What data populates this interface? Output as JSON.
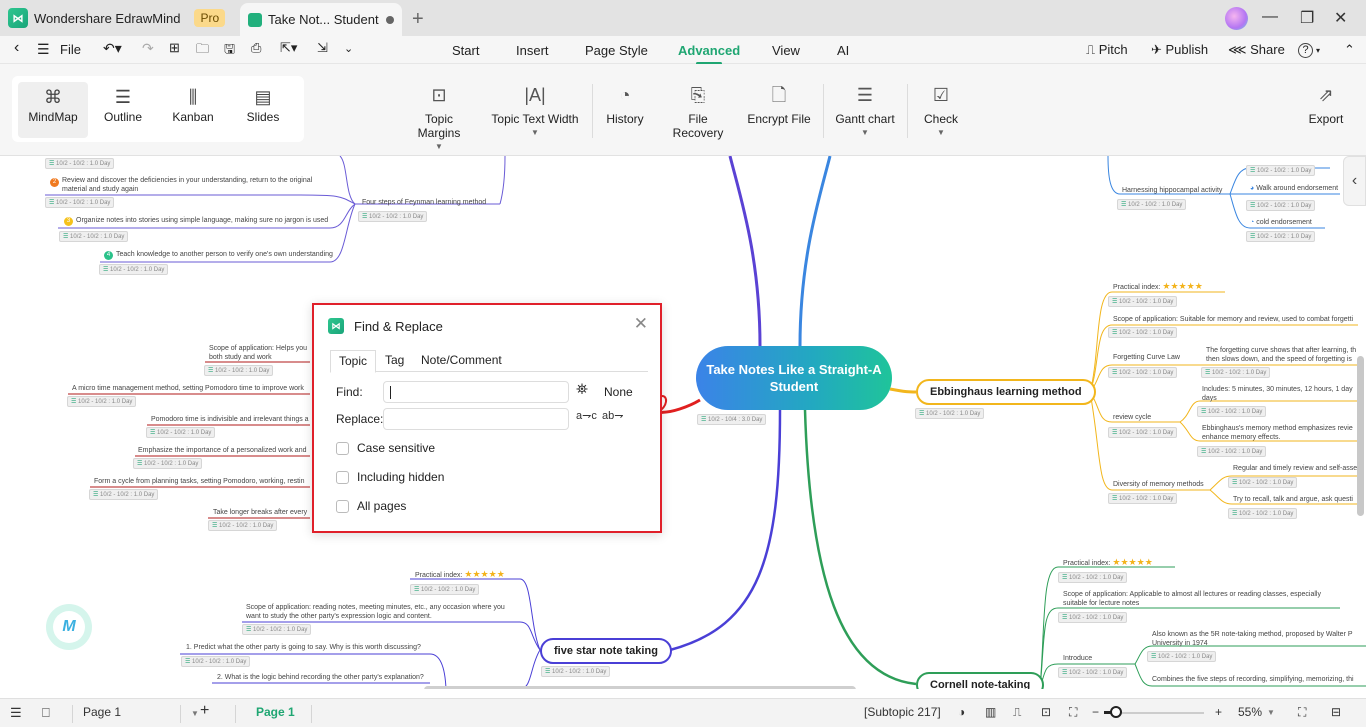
{
  "titlebar": {
    "app_name": "Wondershare EdrawMind",
    "badge": "Pro",
    "doc_tab": "Take Not... Student",
    "new_tab": "+",
    "minimize": "—",
    "restore": "❐",
    "close": "✕"
  },
  "menubar": {
    "back": "‹",
    "menu": "☰",
    "file": "File",
    "tabs": [
      "Start",
      "Insert",
      "Page Style",
      "Advanced",
      "View",
      "AI"
    ],
    "active_tab": "Advanced",
    "right": {
      "pitch": "Pitch",
      "publish": "Publish",
      "share": "Share",
      "help": "?",
      "collapse": "⌃"
    }
  },
  "ribbon": {
    "views": [
      {
        "label": "MindMap",
        "icon": "mindmap-icon",
        "active": true
      },
      {
        "label": "Outline",
        "icon": "outline-icon"
      },
      {
        "label": "Kanban",
        "icon": "kanban-icon"
      },
      {
        "label": "Slides",
        "icon": "slides-icon"
      }
    ],
    "tools": [
      {
        "label": "Topic Margins",
        "icon": "topic-margins-icon",
        "dropdown": true
      },
      {
        "label": "Topic Text Width",
        "icon": "topic-text-width-icon",
        "dropdown": true
      },
      {
        "label": "History",
        "icon": "history-icon"
      },
      {
        "label": "File Recovery",
        "icon": "file-recovery-icon"
      },
      {
        "label": "Encrypt File",
        "icon": "encrypt-file-icon"
      },
      {
        "label": "Gantt chart",
        "icon": "gantt-chart-icon",
        "dropdown": true
      },
      {
        "label": "Check",
        "icon": "check-icon",
        "dropdown": true
      },
      {
        "label": "Export",
        "icon": "export-icon"
      }
    ]
  },
  "mindmap": {
    "central": "Take Notes Like a Straight-A Student",
    "central_tag": "10/2 - 10/4 : 3.0 Day",
    "main_topics": [
      {
        "label": "Ebbinghaus learning method",
        "color": "#f2b61c",
        "tag": "10/2 - 10/2 : 1.0 Day"
      },
      {
        "label": "five star note taking",
        "color": "#4a3fd6",
        "tag": "10/2 - 10/2 : 1.0 Day"
      },
      {
        "label": "Cornell note-taking",
        "color": "#2e9e58"
      }
    ],
    "feynman": {
      "label": "Four steps of Feynman learning method",
      "tag": "10/2 - 10/2 : 1.0 Day",
      "steps": [
        {
          "num": "2",
          "text": "Review and discover the deficiencies in your understanding, return to the original",
          "text2": "material and study again",
          "tag": "10/2 - 10/2 : 1.0 Day"
        },
        {
          "num": "3",
          "text": "Organize notes into stories using simple language, making sure no jargon is used",
          "tag": "10/2 - 10/2 : 1.0 Day"
        },
        {
          "num": "4",
          "text": "Teach knowledge to another person to verify one's own understanding",
          "tag": "10/2 - 10/2 : 1.0 Day"
        }
      ],
      "top_tag": "10/2 - 10/2 : 1.0 Day"
    },
    "pomodoro": [
      {
        "text": "Scope of application: Helps you",
        "text2": "both study and work",
        "tag": "10/2 - 10/2 : 1.0 Day"
      },
      {
        "text": "A micro time management method, setting Pomodoro time to improve work",
        "tag": "10/2 - 10/2 : 1.0 Day"
      },
      {
        "text": "Pomodoro time is indivisible and irrelevant things a",
        "tag": "10/2 - 10/2 : 1.0 Day"
      },
      {
        "text": "Emphasize the importance of a personalized work and",
        "tag": "10/2 - 10/2 : 1.0 Day"
      },
      {
        "text": "Form a cycle from planning tasks, setting Pomodoro, working, restin",
        "tag": "10/2 - 10/2 : 1.0 Day"
      },
      {
        "text": "Take longer breaks after every",
        "tag": "10/2 - 10/2 : 1.0 Day"
      }
    ],
    "hippocampal": {
      "label": "Harnessing hippocampal activity",
      "tag": "10/2 - 10/2 : 1.0 Day",
      "items": [
        {
          "text": "",
          "tag": "10/2 - 10/2 : 1.0 Day"
        },
        {
          "text": "Walk around endorsement",
          "tag": "10/2 - 10/2 : 1.0 Day"
        },
        {
          "text": "cold endorsement",
          "tag": "10/2 - 10/2 : 1.0 Day"
        }
      ]
    },
    "ebbinghaus": {
      "practical_label": "Practical index:",
      "practical_stars": 5,
      "practical_tag": "10/2 - 10/2 : 1.0 Day",
      "scope": "Scope of application: Suitable for memory and review, used to combat forgetti",
      "scope_tag": "10/2 - 10/2 : 1.0 Day",
      "forgetting": "Forgetting Curve Law",
      "forgetting_tag": "10/2 - 10/2 : 1.0 Day",
      "forgetting_detail": "The forgetting curve shows that after learning, th",
      "forgetting_detail2": "then slows down, and the speed of forgetting is",
      "forgetting_detail_tag": "10/2 - 10/2 : 1.0 Day",
      "review": "review cycle",
      "review_tag": "10/2 - 10/2 : 1.0 Day",
      "review_a": "Includes: 5 minutes, 30 minutes, 12 hours, 1 day",
      "review_a2": "days",
      "review_a_tag": "10/2 - 10/2 : 1.0 Day",
      "review_b": "Ebbinghaus's memory method emphasizes revie",
      "review_b2": "enhance memory effects.",
      "review_b_tag": "10/2 - 10/2 : 1.0 Day",
      "diversity": "Diversity of memory methods",
      "diversity_tag": "10/2 - 10/2 : 1.0 Day",
      "diversity_a": "Regular and timely review and self-asse",
      "diversity_a_tag": "10/2 - 10/2 : 1.0 Day",
      "diversity_b": "Try to recall, talk and argue, ask questi",
      "diversity_b_tag": "10/2 - 10/2 : 1.0 Day"
    },
    "five_star": {
      "practical_label": "Practical index:",
      "practical_stars": 5,
      "practical_tag": "10/2 - 10/2 : 1.0 Day",
      "scope": "Scope of application: reading notes, meeting minutes, etc., any occasion where you",
      "scope2": "want to study the other party's expression logic and content.",
      "scope_tag": "10/2 - 10/2 : 1.0 Day",
      "q1": "1. Predict what the other party is going to say. Why is this worth discussing?",
      "q1_tag": "10/2 - 10/2 : 1.0 Day",
      "q2": "2. What is the logic behind recording the other party's explanation?"
    },
    "cornell": {
      "practical_label": "Practical index:",
      "practical_stars": 5,
      "practical_tag": "10/2 - 10/2 : 1.0 Day",
      "scope": "Scope of application: Applicable to almost all lectures or reading classes, especially",
      "scope2": "suitable for lecture notes",
      "scope_tag": "10/2 - 10/2 : 1.0 Day",
      "introduce": "Introduce",
      "introduce_tag": "10/2 - 10/2 : 1.0 Day",
      "intro_a": "Also known as the 5R note-taking method, proposed by Walter P",
      "intro_a2": "University in 1974",
      "intro_a_tag": "10/2 - 10/2 : 1.0 Day",
      "intro_b": "Combines the five steps of recording, simplifying, memorizing, thi"
    }
  },
  "dialog": {
    "title": "Find & Replace",
    "tabs": [
      "Topic",
      "Tag",
      "Note/Comment"
    ],
    "active_tab": "Topic",
    "find_label": "Find:",
    "find_value": "",
    "replace_label": "Replace:",
    "replace_value": "",
    "result": "None",
    "options": [
      {
        "label": "Case sensitive",
        "checked": false
      },
      {
        "label": "Including hidden",
        "checked": false
      },
      {
        "label": "All pages",
        "checked": false
      }
    ]
  },
  "statusbar": {
    "page_select": "Page 1",
    "add_page": "+",
    "active_page": "Page 1",
    "selection": "[Subtopic 217]",
    "zoom_percent": 55,
    "zoom_label": "55%",
    "zoom_minus": "−",
    "zoom_plus": "+"
  }
}
